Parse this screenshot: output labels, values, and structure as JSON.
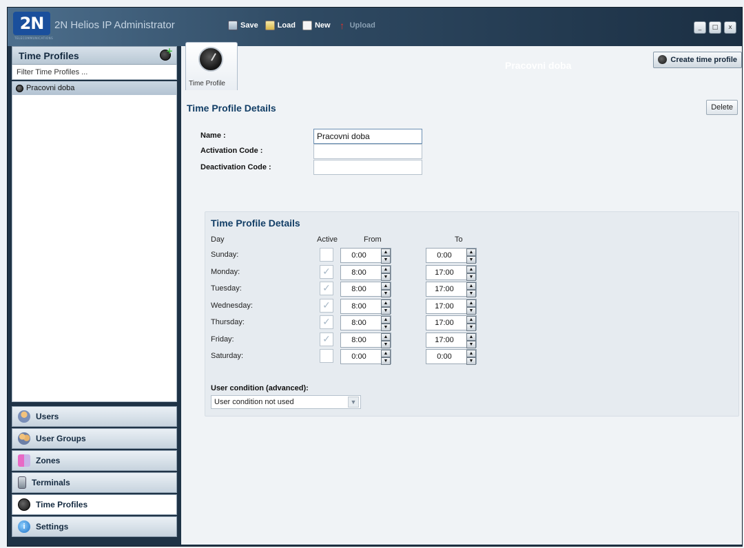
{
  "app": {
    "logo_text": "2N",
    "logo_sub": "TELECOMMUNICATIONS",
    "title": "2N Helios IP Administrator"
  },
  "toolbar": {
    "save": "Save",
    "load": "Load",
    "new": "New",
    "upload": "Upload"
  },
  "window_controls": {
    "minimize": "_",
    "maximize": "□",
    "close": "x"
  },
  "sidebar": {
    "header": "Time Profiles",
    "filter_placeholder": "Filter Time Profiles ...",
    "items": [
      {
        "label": "Pracovni doba"
      }
    ],
    "nav": [
      {
        "label": "Users",
        "icon": "users-icon"
      },
      {
        "label": "User Groups",
        "icon": "user-groups-icon"
      },
      {
        "label": "Zones",
        "icon": "zones-icon"
      },
      {
        "label": "Terminals",
        "icon": "terminals-icon"
      },
      {
        "label": "Time Profiles",
        "icon": "clock-icon",
        "active": true
      },
      {
        "label": "Settings",
        "icon": "settings-icon"
      }
    ]
  },
  "main": {
    "tab_label": "Time Profile",
    "profile_name_title": "Pracovni doba",
    "create_button": "Create time profile",
    "details_title": "Time Profile Details",
    "delete_button": "Delete",
    "form": {
      "name_label": "Name :",
      "name_value": "Pracovni doba",
      "activation_label": "Activation Code :",
      "activation_value": "",
      "deactivation_label": "Deactivation Code :",
      "deactivation_value": ""
    },
    "schedule": {
      "title": "Time Profile Details",
      "headers": {
        "day": "Day",
        "active": "Active",
        "from": "From",
        "to": "To"
      },
      "days": [
        {
          "day": "Sunday:",
          "active": false,
          "from": "0:00",
          "to": "0:00"
        },
        {
          "day": "Monday:",
          "active": true,
          "from": "8:00",
          "to": "17:00"
        },
        {
          "day": "Tuesday:",
          "active": true,
          "from": "8:00",
          "to": "17:00"
        },
        {
          "day": "Wednesday:",
          "active": true,
          "from": "8:00",
          "to": "17:00"
        },
        {
          "day": "Thursday:",
          "active": true,
          "from": "8:00",
          "to": "17:00"
        },
        {
          "day": "Friday:",
          "active": true,
          "from": "8:00",
          "to": "17:00"
        },
        {
          "day": "Saturday:",
          "active": false,
          "from": "0:00",
          "to": "0:00"
        }
      ],
      "check_mark": "✓",
      "user_condition_label": "User condition (advanced):",
      "user_condition_value": "User condition not used"
    }
  },
  "colors": {
    "title_gradient_start": "#4d6f8d",
    "title_gradient_end": "#1b2f43",
    "heading_blue": "#123e66",
    "content_bg": "#f0f3f6"
  }
}
